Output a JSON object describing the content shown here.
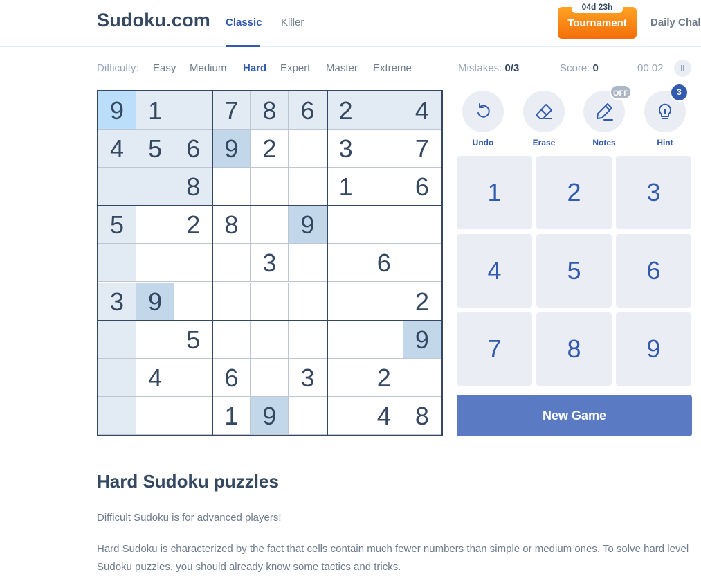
{
  "header": {
    "logo": "Sudoku.com",
    "tabs": [
      {
        "label": "Classic",
        "active": true
      },
      {
        "label": "Killer",
        "active": false
      }
    ],
    "tournament": {
      "countdown": "04d 23h",
      "label": "Tournament"
    },
    "daily_label": "Daily Chall"
  },
  "game_bar": {
    "difficulty_label": "Difficulty:",
    "levels": [
      "Easy",
      "Medium",
      "Hard",
      "Expert",
      "Master",
      "Extreme"
    ],
    "active_level": "Hard",
    "mistakes_label": "Mistakes:",
    "mistakes_value": "0/3",
    "score_label": "Score:",
    "score_value": "0",
    "timer": "00:02"
  },
  "board": {
    "rows": [
      [
        "9",
        "1",
        "",
        "7",
        "8",
        "6",
        "2",
        "",
        "4"
      ],
      [
        "4",
        "5",
        "6",
        "9",
        "2",
        "",
        "3",
        "",
        "7"
      ],
      [
        "",
        "",
        "8",
        "",
        "",
        "",
        "1",
        "",
        "6"
      ],
      [
        "5",
        "",
        "2",
        "8",
        "",
        "9",
        "",
        "",
        ""
      ],
      [
        "",
        "",
        "",
        "",
        "3",
        "",
        "",
        "6",
        ""
      ],
      [
        "3",
        "9",
        "",
        "",
        "",
        "",
        "",
        "",
        "2"
      ],
      [
        "",
        "",
        "5",
        "",
        "",
        "",
        "",
        "",
        "9"
      ],
      [
        "",
        "4",
        "",
        "6",
        "",
        "3",
        "",
        "2",
        ""
      ],
      [
        "",
        "",
        "",
        "1",
        "9",
        "",
        "",
        "4",
        "8"
      ]
    ],
    "selected": "0,0",
    "same_value_cells": [
      "1,3",
      "3,5",
      "5,1",
      "6,8",
      "8,4"
    ],
    "related_cells": [
      "0,1",
      "0,2",
      "0,3",
      "0,4",
      "0,5",
      "0,6",
      "0,7",
      "0,8",
      "1,0",
      "1,1",
      "1,2",
      "2,0",
      "2,1",
      "2,2",
      "3,0",
      "4,0",
      "5,0",
      "6,0",
      "7,0",
      "8,0"
    ]
  },
  "tools": [
    {
      "label": "Undo",
      "icon": "undo-icon"
    },
    {
      "label": "Erase",
      "icon": "eraser-icon"
    },
    {
      "label": "Notes",
      "icon": "pencil-icon",
      "badge": "OFF"
    },
    {
      "label": "Hint",
      "icon": "lightbulb-icon",
      "badge": "3"
    }
  ],
  "numpad": [
    "1",
    "2",
    "3",
    "4",
    "5",
    "6",
    "7",
    "8",
    "9"
  ],
  "new_game_label": "New Game",
  "article": {
    "title": "Hard Sudoku puzzles",
    "p1": "Difficult Sudoku is for advanced players!",
    "p2": "Hard Sudoku is characterized by the fact that cells contain much fewer numbers than simple or medium ones. To solve hard level Sudoku puzzles, you should already know some tactics and tricks."
  },
  "colors": {
    "primary": "#325aaf",
    "text": "#344861",
    "tournament": "#f46e0a",
    "new_game": "#5a7bc4"
  }
}
